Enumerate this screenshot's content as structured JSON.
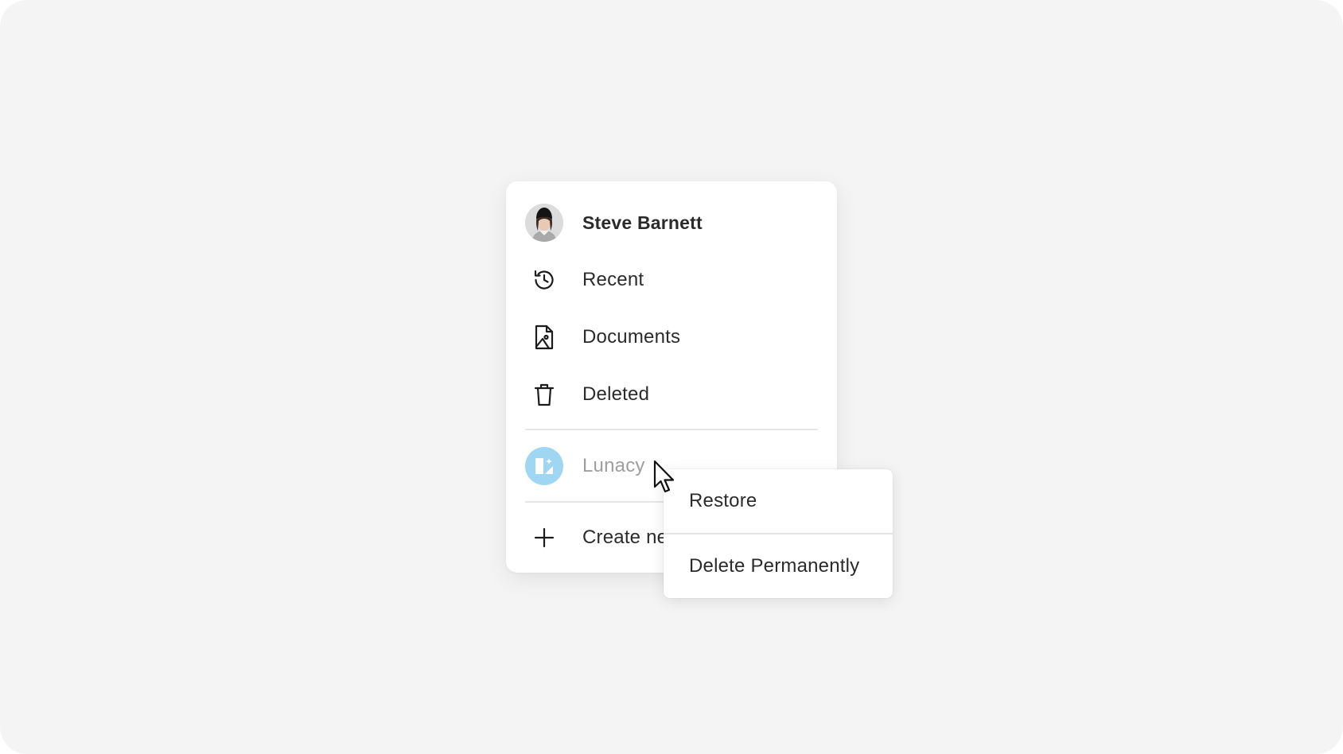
{
  "menu": {
    "user": {
      "name": "Steve Barnett",
      "icon": "avatar"
    },
    "items": [
      {
        "label": "Recent",
        "icon": "history-icon"
      },
      {
        "label": "Documents",
        "icon": "document-icon"
      },
      {
        "label": "Deleted",
        "icon": "trash-icon"
      }
    ],
    "team": {
      "label": "Lunacy",
      "icon": "lunacy-logo",
      "color": "#9fd6f1"
    },
    "create": {
      "label": "Create new",
      "icon": "plus-icon"
    }
  },
  "context_menu": {
    "items": [
      {
        "label": "Restore"
      },
      {
        "label": "Delete Permanently"
      }
    ]
  },
  "colors": {
    "background": "#f4f4f4",
    "panel": "#ffffff",
    "text": "#2b2b2b",
    "muted_text": "#9e9e9e",
    "accent": "#9fd6f1"
  }
}
